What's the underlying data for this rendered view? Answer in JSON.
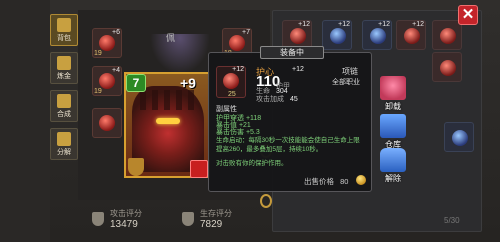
{
  "left_tabs": [
    {
      "label": "背包",
      "active": true
    },
    {
      "label": "炼金"
    },
    {
      "label": "合成"
    },
    {
      "label": "分解"
    }
  ],
  "equipment": {
    "lamp_label": "佩",
    "slot_top_plus": "+6",
    "slot_top_lvl": "19",
    "slot_a_plus": "+4",
    "slot_a_lvl": "19",
    "slot_b_plus": "+12",
    "slot_b_lvl": "25",
    "slot_c_plus": "+7",
    "slot_c_lvl": "18"
  },
  "hero_card": {
    "level": "7",
    "plus": "+9"
  },
  "scores": {
    "attack_label": "攻击评分",
    "attack_value": "13479",
    "survival_label": "生存评分",
    "survival_value": "7829"
  },
  "inventory": {
    "items": [
      {
        "plus": "+12"
      },
      {
        "plus": "+12"
      },
      {
        "plus": "+12"
      },
      {
        "plus": "+12"
      },
      {
        "plus": ""
      },
      {
        "plus": ""
      },
      {
        "plus": ""
      }
    ],
    "count": "5/30"
  },
  "tooltip": {
    "tab_label": "装备中",
    "item_plus": "+12",
    "item_level": "25",
    "name": "护心",
    "name_plus": "+12",
    "type": "项链",
    "power": "110",
    "power_label": "护甲",
    "class_req": "全部职业",
    "stats": [
      {
        "k": "生命",
        "v": "304"
      },
      {
        "k": "攻击加成",
        "v": "45"
      }
    ],
    "sub_heading": "副属性",
    "attrs": [
      "护甲穿透 +118",
      "暴击值 +21",
      "暴击伤害 +5.3"
    ],
    "desc": "生命启动：每隔30秒一次技能能会使自己生命上限提高260，最多叠加5层，持续10秒。",
    "desc2": "对击败有你的保护作用。",
    "price_label": "出售价格",
    "price_value": "80"
  },
  "actions": {
    "unload": "卸载",
    "warehouse": "仓库",
    "unlock": "解除"
  },
  "close_symbol": "✕"
}
